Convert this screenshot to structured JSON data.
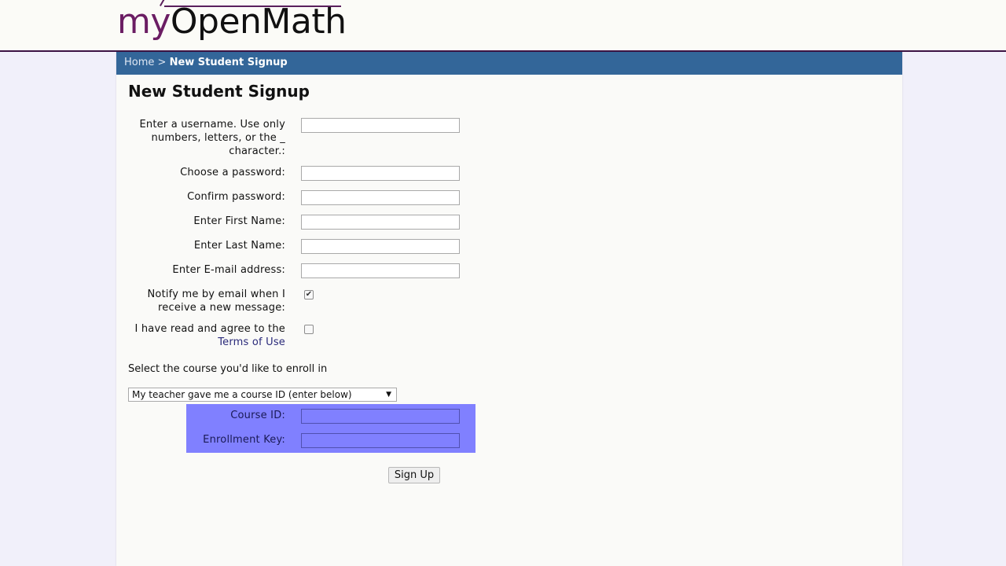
{
  "logo": {
    "my": "my",
    "rest": "OpenMath"
  },
  "breadcrumb": {
    "home": "Home",
    "separator": " > ",
    "current": "New Student Signup"
  },
  "page_title": "New Student Signup",
  "form": {
    "username_label": "Enter a username. Use only numbers, letters, or the _ character.:",
    "password_label": "Choose a password:",
    "confirm_label": "Confirm password:",
    "first_name_label": "Enter First Name:",
    "last_name_label": "Enter Last Name:",
    "email_label": "Enter E-mail address:",
    "notify_label": "Notify me by email when I receive a new message:",
    "notify_checked": true,
    "agree_label": "I have read and agree to the",
    "terms_link": "Terms of Use",
    "agree_checked": false
  },
  "course": {
    "select_prompt": "Select the course you'd like to enroll in",
    "selected_option": "My teacher gave me a course ID (enter below)",
    "course_id_label": "Course ID:",
    "enrollment_key_label": "Enrollment Key:"
  },
  "signup_button": "Sign Up",
  "colors": {
    "breadcrumb_bg": "#336699",
    "highlight": "#8080ff",
    "header_rule": "#3d1444"
  }
}
